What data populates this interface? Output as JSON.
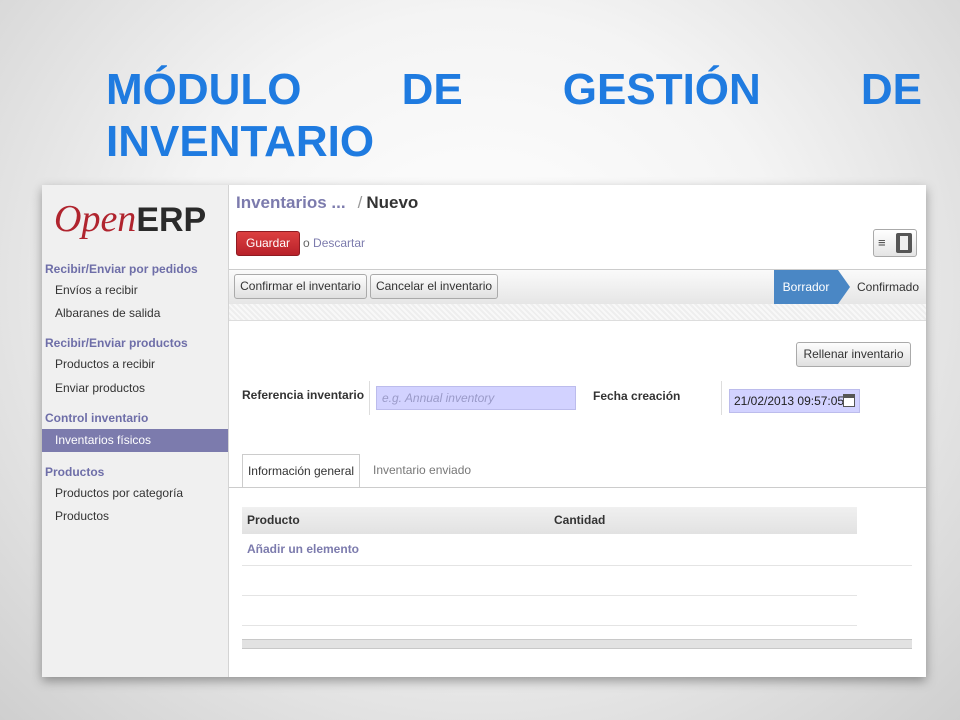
{
  "slide": {
    "title": "MÓDULO DE GESTIÓN DE INVENTARIO"
  },
  "logo": {
    "open": "Open",
    "erp": "ERP"
  },
  "sidebar": {
    "sections": [
      {
        "label": "Recibir/Enviar por pedidos",
        "items": [
          "Envíos a recibir",
          "Albaranes de salida"
        ]
      },
      {
        "label": "Recibir/Enviar productos",
        "items": [
          "Productos a recibir",
          "Enviar productos"
        ]
      },
      {
        "label": "Control inventario",
        "items": [
          "Inventarios físicos"
        ]
      },
      {
        "label": "Productos",
        "items": [
          "Productos por categoría",
          "Productos"
        ]
      }
    ],
    "active_item": "Inventarios físicos"
  },
  "breadcrumb": {
    "parent": "Inventarios ...",
    "separator": "/",
    "current": "Nuevo"
  },
  "actions": {
    "save_label": "Guardar",
    "or_text": "o",
    "discard_label": "Descartar"
  },
  "view_switch": {
    "list_icon": "list-icon",
    "form_icon": "form-view-icon"
  },
  "statusbar": {
    "confirm_label": "Confirmar el inventario",
    "cancel_label": "Cancelar el inventario",
    "stages": [
      "Borrador",
      "Confirmado"
    ],
    "active_stage": "Borrador"
  },
  "form": {
    "fill_button": "Rellenar inventario",
    "reference_label": "Referencia inventario",
    "reference_placeholder": "e.g. Annual inventory",
    "reference_value": "",
    "date_label": "Fecha creación",
    "date_value": "21/02/2013 09:57:05"
  },
  "tabs": [
    {
      "label": "Información general",
      "active": true
    },
    {
      "label": "Inventario enviado",
      "active": false
    }
  ],
  "table": {
    "columns": [
      "Producto",
      "Cantidad"
    ],
    "add_item_label": "Añadir un elemento"
  },
  "colors": {
    "title": "#1f7be0",
    "accent": "#7c7bad",
    "save": "#c52a33",
    "stage_active": "#4a87c5"
  }
}
